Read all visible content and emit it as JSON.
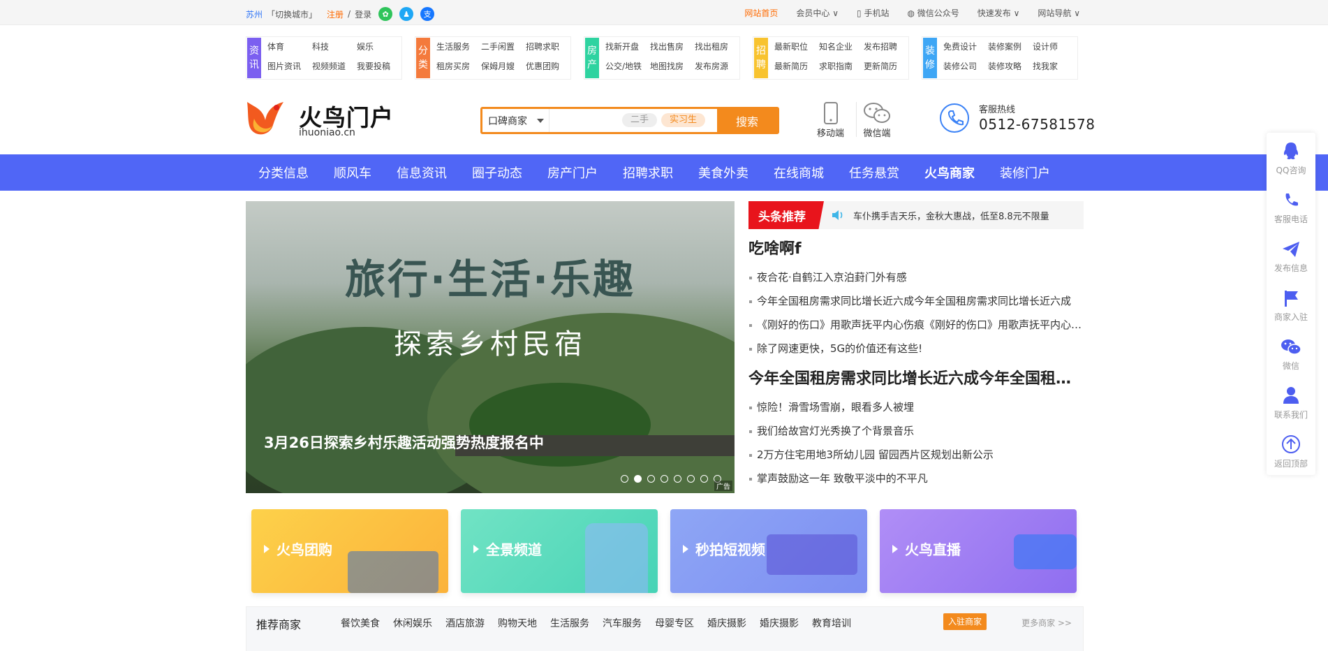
{
  "topbar": {
    "city": "苏州",
    "switch_city": "「切换城市」",
    "register": "注册",
    "sep": "/",
    "login": "登录",
    "right": [
      {
        "label": "网站首页",
        "highlight": true
      },
      {
        "label": "会员中心 ∨"
      },
      {
        "label": "手机站"
      },
      {
        "label": "微信公众号"
      },
      {
        "label": "快速发布 ∨"
      },
      {
        "label": "网站导航 ∨"
      }
    ]
  },
  "categories": [
    {
      "tag": [
        "资",
        "讯"
      ],
      "color": "#7b5ff0",
      "links": [
        "体育",
        "科技",
        "娱乐",
        "图片资讯",
        "视频频道",
        "我要投稿"
      ]
    },
    {
      "tag": [
        "分",
        "类"
      ],
      "color": "#f47a3c",
      "links": [
        "生活服务",
        "二手闲置",
        "招聘求职",
        "租房买房",
        "保姆月嫂",
        "优惠团购"
      ]
    },
    {
      "tag": [
        "房",
        "产"
      ],
      "color": "#2ed3a0",
      "links": [
        "找新开盘",
        "找出售房",
        "找出租房",
        "公交/地铁",
        "地图找房",
        "发布房源"
      ]
    },
    {
      "tag": [
        "招",
        "聘"
      ],
      "color": "#f8c32f",
      "links": [
        "最新职位",
        "知名企业",
        "发布招聘",
        "最新简历",
        "求职指南",
        "更新简历"
      ]
    },
    {
      "tag": [
        "装",
        "修"
      ],
      "color": "#3ea6f5",
      "links": [
        "免费设计",
        "装修案例",
        "设计师",
        "装修公司",
        "装修攻略",
        "找我家"
      ]
    }
  ],
  "logo": {
    "name": "火鸟门户",
    "domain": "ihuoniao.cn"
  },
  "search": {
    "scope": "口碑商家",
    "tags": [
      "二手",
      "实习生"
    ],
    "button": "搜索"
  },
  "devices": {
    "mobile": "移动端",
    "wechat": "微信端"
  },
  "hotline": {
    "label": "客服热线",
    "number": "0512-67581578"
  },
  "nav": [
    "分类信息",
    "顺风车",
    "信息资讯",
    "圈子动态",
    "房产门户",
    "招聘求职",
    "美食外卖",
    "在线商城",
    "任务悬赏",
    "火鸟商家",
    "装修门户"
  ],
  "banner": {
    "title": "旅行·生活·乐趣",
    "subtitle": "探索乡村民宿",
    "caption": "3月26日探索乡村乐趣活动强势热度报名中",
    "ad": "广告",
    "slides": 8,
    "active": 1
  },
  "news": {
    "label": "头条推荐",
    "ticker": "车仆携手吉天乐，金秋大惠战，低至8.8元不限量",
    "headline1": "吃啥啊f",
    "list1": [
      "夜合花·自鹤江入京泊葑门外有感",
      "今年全国租房需求同比增长近六成今年全国租房需求同比增长近六成",
      "《刚好的伤口》用歌声抚平内心伤痕《刚好的伤口》用歌声抚平内心伤痕",
      "除了网速更快，5G的价值还有这些!"
    ],
    "headline2": "今年全国租房需求同比增长近六成今年全国租房需求同比增长近六成",
    "list2": [
      "惊险！滑雪场雪崩，眼看多人被埋",
      "我们给故宫灯光秀换了个背景音乐",
      "2万方住宅用地3所幼儿园 留园西片区规划出新公示",
      "掌声鼓励这一年 致敬平淡中的不平凡"
    ]
  },
  "cards": [
    {
      "label": "火鸟团购",
      "color1": "#fdd14a",
      "color2": "#fbb23a"
    },
    {
      "label": "全景频道",
      "color1": "#71e3c4",
      "color2": "#47d3b6"
    },
    {
      "label": "秒拍短视频",
      "color1": "#8ea6f5",
      "color2": "#7d8ef2"
    },
    {
      "label": "火鸟直播",
      "color1": "#b08ef6",
      "color2": "#8f6ef0"
    }
  ],
  "merchants": {
    "title": "推荐商家",
    "cats": [
      "餐饮美食",
      "休闲娱乐",
      "酒店旅游",
      "购物天地",
      "生活服务",
      "汽车服务",
      "母婴专区",
      "婚庆摄影",
      "婚庆摄影",
      "教育培训"
    ],
    "join": "入驻商家",
    "more": "更多商家 >>"
  },
  "sidebar": [
    "QQ咨询",
    "客服电话",
    "发布信息",
    "商家入驻",
    "微信",
    "联系我们",
    "返回顶部"
  ]
}
